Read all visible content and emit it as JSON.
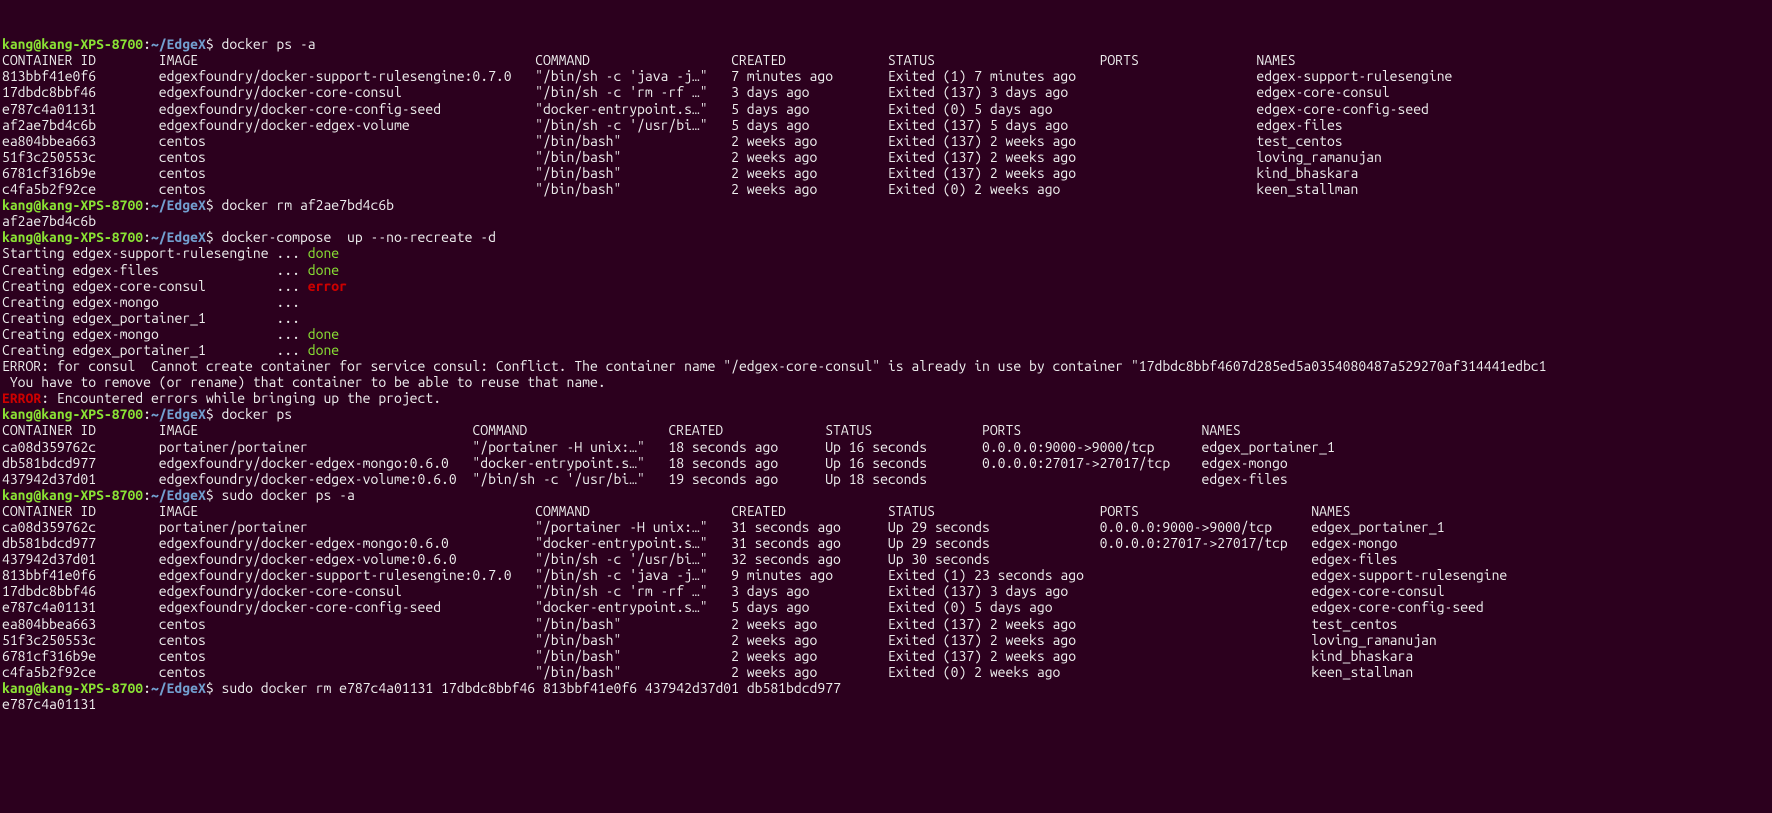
{
  "prompt": {
    "user": "kang",
    "host": "kang-XPS-8700",
    "path": "~/EdgeX",
    "symbol": "$"
  },
  "seg1": {
    "cmd": "docker ps -a",
    "header": {
      "id": "CONTAINER ID",
      "image": "IMAGE",
      "command": "COMMAND",
      "created": "CREATED",
      "status": "STATUS",
      "ports": "PORTS",
      "names": "NAMES"
    },
    "rows": [
      {
        "id": "813bbf41e0f6",
        "image": "edgexfoundry/docker-support-rulesengine:0.7.0",
        "command": "\"/bin/sh -c 'java -j…\"",
        "created": "7 minutes ago",
        "status": "Exited (1) 7 minutes ago",
        "ports": "",
        "names": "edgex-support-rulesengine"
      },
      {
        "id": "17dbdc8bbf46",
        "image": "edgexfoundry/docker-core-consul",
        "command": "\"/bin/sh -c 'rm -rf …\"",
        "created": "3 days ago",
        "status": "Exited (137) 3 days ago",
        "ports": "",
        "names": "edgex-core-consul"
      },
      {
        "id": "e787c4a01131",
        "image": "edgexfoundry/docker-core-config-seed",
        "command": "\"docker-entrypoint.s…\"",
        "created": "5 days ago",
        "status": "Exited (0) 5 days ago",
        "ports": "",
        "names": "edgex-core-config-seed"
      },
      {
        "id": "af2ae7bd4c6b",
        "image": "edgexfoundry/docker-edgex-volume",
        "command": "\"/bin/sh -c '/usr/bi…\"",
        "created": "5 days ago",
        "status": "Exited (137) 5 days ago",
        "ports": "",
        "names": "edgex-files"
      },
      {
        "id": "ea804bbea663",
        "image": "centos",
        "command": "\"/bin/bash\"",
        "created": "2 weeks ago",
        "status": "Exited (137) 2 weeks ago",
        "ports": "",
        "names": "test_centos"
      },
      {
        "id": "51f3c250553c",
        "image": "centos",
        "command": "\"/bin/bash\"",
        "created": "2 weeks ago",
        "status": "Exited (137) 2 weeks ago",
        "ports": "",
        "names": "loving_ramanujan"
      },
      {
        "id": "6781cf316b9e",
        "image": "centos",
        "command": "\"/bin/bash\"",
        "created": "2 weeks ago",
        "status": "Exited (137) 2 weeks ago",
        "ports": "",
        "names": "kind_bhaskara"
      },
      {
        "id": "c4fa5b2f92ce",
        "image": "centos",
        "command": "\"/bin/bash\"",
        "created": "2 weeks ago",
        "status": "Exited (0) 2 weeks ago",
        "ports": "",
        "names": "keen_stallman"
      }
    ]
  },
  "seg2": {
    "cmd": "docker rm af2ae7bd4c6b",
    "out": "af2ae7bd4c6b"
  },
  "seg3": {
    "cmd": "docker-compose  up --no-recreate -d",
    "lines": [
      {
        "textA": "Starting edgex-support-rulesengine ",
        "textB": "... ",
        "status": "done",
        "cls": "done"
      },
      {
        "textA": "Creating edgex-files               ",
        "textB": "... ",
        "status": "done",
        "cls": "done"
      },
      {
        "textA": "Creating edgex-core-consul         ",
        "textB": "... ",
        "status": "error",
        "cls": "err"
      },
      {
        "textA": "Creating edgex-mongo               ",
        "textB": "... ",
        "status": "",
        "cls": ""
      },
      {
        "textA": "Creating edgex_portainer_1         ",
        "textB": "... ",
        "status": "",
        "cls": ""
      },
      {
        "textA": "",
        "textB": "",
        "status": "",
        "cls": ""
      },
      {
        "textA": "Creating edgex-mongo               ",
        "textB": "... ",
        "status": "done",
        "cls": "done"
      },
      {
        "textA": "Creating edgex_portainer_1         ",
        "textB": "... ",
        "status": "done",
        "cls": "done"
      }
    ],
    "tail": [
      "",
      "ERROR: for consul  Cannot create container for service consul: Conflict. The container name \"/edgex-core-consul\" is already in use by container \"17dbdc8bbf4607d285ed5a0354080487a529270af314441edbc1",
      " You have to remove (or rename) that container to be able to reuse that name."
    ],
    "errline": {
      "label": "ERROR",
      "rest": ": Encountered errors while bringing up the project."
    }
  },
  "seg4": {
    "cmd": "docker ps",
    "header": {
      "id": "CONTAINER ID",
      "image": "IMAGE",
      "command": "COMMAND",
      "created": "CREATED",
      "status": "STATUS",
      "ports": "PORTS",
      "names": "NAMES"
    },
    "rows": [
      {
        "id": "ca08d359762c",
        "image": "portainer/portainer",
        "command": "\"/portainer -H unix:…\"",
        "created": "18 seconds ago",
        "status": "Up 16 seconds",
        "ports": "0.0.0.0:9000->9000/tcp",
        "names": "edgex_portainer_1"
      },
      {
        "id": "db581bdcd977",
        "image": "edgexfoundry/docker-edgex-mongo:0.6.0",
        "command": "\"docker-entrypoint.s…\"",
        "created": "18 seconds ago",
        "status": "Up 16 seconds",
        "ports": "0.0.0.0:27017->27017/tcp",
        "names": "edgex-mongo"
      },
      {
        "id": "437942d37d01",
        "image": "edgexfoundry/docker-edgex-volume:0.6.0",
        "command": "\"/bin/sh -c '/usr/bi…\"",
        "created": "19 seconds ago",
        "status": "Up 18 seconds",
        "ports": "",
        "names": "edgex-files"
      }
    ]
  },
  "seg5": {
    "cmd": "sudo docker ps -a",
    "header": {
      "id": "CONTAINER ID",
      "image": "IMAGE",
      "command": "COMMAND",
      "created": "CREATED",
      "status": "STATUS",
      "ports": "PORTS",
      "names": "NAMES"
    },
    "rows": [
      {
        "id": "ca08d359762c",
        "image": "portainer/portainer",
        "command": "\"/portainer -H unix:…\"",
        "created": "31 seconds ago",
        "status": "Up 29 seconds",
        "ports": "0.0.0.0:9000->9000/tcp",
        "names": "edgex_portainer_1"
      },
      {
        "id": "db581bdcd977",
        "image": "edgexfoundry/docker-edgex-mongo:0.6.0",
        "command": "\"docker-entrypoint.s…\"",
        "created": "31 seconds ago",
        "status": "Up 29 seconds",
        "ports": "0.0.0.0:27017->27017/tcp",
        "names": "edgex-mongo"
      },
      {
        "id": "437942d37d01",
        "image": "edgexfoundry/docker-edgex-volume:0.6.0",
        "command": "\"/bin/sh -c '/usr/bi…\"",
        "created": "32 seconds ago",
        "status": "Up 30 seconds",
        "ports": "",
        "names": "edgex-files"
      },
      {
        "id": "813bbf41e0f6",
        "image": "edgexfoundry/docker-support-rulesengine:0.7.0",
        "command": "\"/bin/sh -c 'java -j…\"",
        "created": "9 minutes ago",
        "status": "Exited (1) 23 seconds ago",
        "ports": "",
        "names": "edgex-support-rulesengine"
      },
      {
        "id": "17dbdc8bbf46",
        "image": "edgexfoundry/docker-core-consul",
        "command": "\"/bin/sh -c 'rm -rf …\"",
        "created": "3 days ago",
        "status": "Exited (137) 3 days ago",
        "ports": "",
        "names": "edgex-core-consul"
      },
      {
        "id": "e787c4a01131",
        "image": "edgexfoundry/docker-core-config-seed",
        "command": "\"docker-entrypoint.s…\"",
        "created": "5 days ago",
        "status": "Exited (0) 5 days ago",
        "ports": "",
        "names": "edgex-core-config-seed"
      },
      {
        "id": "ea804bbea663",
        "image": "centos",
        "command": "\"/bin/bash\"",
        "created": "2 weeks ago",
        "status": "Exited (137) 2 weeks ago",
        "ports": "",
        "names": "test_centos"
      },
      {
        "id": "51f3c250553c",
        "image": "centos",
        "command": "\"/bin/bash\"",
        "created": "2 weeks ago",
        "status": "Exited (137) 2 weeks ago",
        "ports": "",
        "names": "loving_ramanujan"
      },
      {
        "id": "6781cf316b9e",
        "image": "centos",
        "command": "\"/bin/bash\"",
        "created": "2 weeks ago",
        "status": "Exited (137) 2 weeks ago",
        "ports": "",
        "names": "kind_bhaskara"
      },
      {
        "id": "c4fa5b2f92ce",
        "image": "centos",
        "command": "\"/bin/bash\"",
        "created": "2 weeks ago",
        "status": "Exited (0) 2 weeks ago",
        "ports": "",
        "names": "keen_stallman"
      }
    ]
  },
  "seg6": {
    "cmd": "sudo docker rm e787c4a01131 17dbdc8bbf46 813bbf41e0f6 437942d37d01 db581bdcd977",
    "out": "e787c4a01131"
  }
}
